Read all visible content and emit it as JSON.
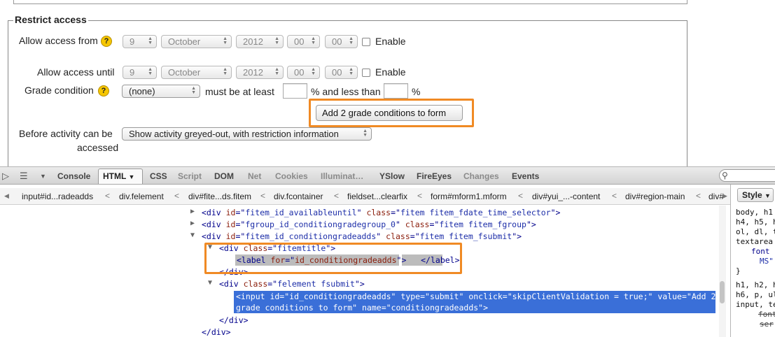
{
  "form": {
    "legend": "Restrict access",
    "allow_from": {
      "label": "Allow access from",
      "day": "9",
      "month": "October",
      "year": "2012",
      "hour": "00",
      "minute": "00",
      "enable_label": "Enable"
    },
    "allow_until": {
      "label": "Allow access until",
      "day": "9",
      "month": "October",
      "year": "2012",
      "hour": "00",
      "minute": "00",
      "enable_label": "Enable"
    },
    "grade_condition": {
      "label": "Grade condition",
      "select": "(none)",
      "min_label": "must be at least",
      "pct1": "%",
      "and_less_than": "% and less than",
      "pct2": "%"
    },
    "add_button": "Add 2 grade conditions to form",
    "before_activity": {
      "label_line1": "Before activity can be",
      "label_line2": "accessed",
      "select": "Show activity greyed-out, with restriction information"
    }
  },
  "firebug": {
    "tabs": [
      "Console",
      "HTML",
      "CSS",
      "Script",
      "DOM",
      "Net",
      "Cookies",
      "Illuminat…",
      "YSlow",
      "FireEyes",
      "Changes",
      "Events"
    ],
    "active_tab": "HTML",
    "breadcrumbs": [
      "input#id...radeadds",
      "div.felement",
      "div#fite...ds.fitem",
      "div.fcontainer",
      "fieldset...clearfix",
      "form#mform1.mform",
      "div#yui_...-content",
      "div#region-main",
      "div#"
    ],
    "tree": {
      "l1_id": "fitem_id_availableuntil",
      "l1_class": "fitem fitem_fdate_time_selector",
      "l2_id": "fgroup_id_conditiongradegroup_0",
      "l2_class": "fitem fitem_fgroup",
      "l3_id": "fitem_id_conditiongradeadds",
      "l3_class": "fitem fitem_fsubmit",
      "l4_class": "fitemtitle",
      "l5_for": "id_conditiongradeadds",
      "l7_class": "felement fsubmit",
      "input_line1": "<input id=\"id_conditiongradeadds\" type=\"submit\" onclick=\"skipClientValidation = true;\" value=\"Add 2",
      "input_line2": "grade conditions to form\" name=\"conditiongradeadds\">",
      "close_div": "</div>"
    },
    "side": {
      "tab": "Style",
      "lines": [
        "body, h1",
        "h4, h5, h",
        "ol, dl, t",
        "textarea",
        "font",
        "MS\"",
        "}",
        "h1, h2, h",
        "h6, p, ul",
        "input, te",
        "font",
        "ser"
      ]
    }
  }
}
